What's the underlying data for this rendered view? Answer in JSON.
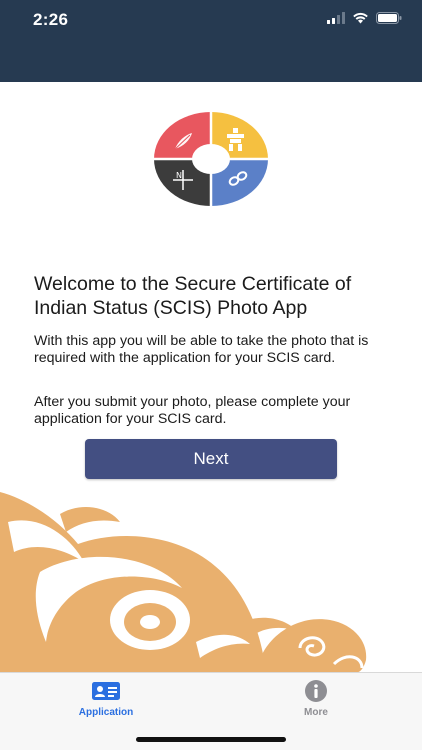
{
  "status_bar": {
    "time": "2:26",
    "icons": [
      "signal-icon",
      "wifi-icon",
      "battery-icon"
    ],
    "background": "#263a51"
  },
  "logo": {
    "colors": {
      "red": "#e8575f",
      "yellow": "#f5c040",
      "dark": "#3c3c3c",
      "blue": "#5b80c8"
    },
    "icons": [
      "feather-icon",
      "inukshuk-icon",
      "compass-icon",
      "infinity-icon"
    ]
  },
  "main": {
    "title": "Welcome to the Secure Certificate of Indian Status (SCIS) Photo App",
    "paragraph_1": "With this app you will be able to take the photo that is required with the application for your SCIS card.",
    "paragraph_2": "After you submit your photo, please complete your application for your SCIS card."
  },
  "buttons": {
    "next_label": "Next",
    "next_color": "#434f82"
  },
  "decoration": {
    "color": "#e9b06e"
  },
  "tab_bar": {
    "tabs": [
      {
        "label": "Application",
        "icon": "id-card-icon",
        "selected": true,
        "color": "#2b6fe0"
      },
      {
        "label": "More",
        "icon": "info-icon",
        "selected": false,
        "color": "#8e8e93"
      }
    ]
  }
}
